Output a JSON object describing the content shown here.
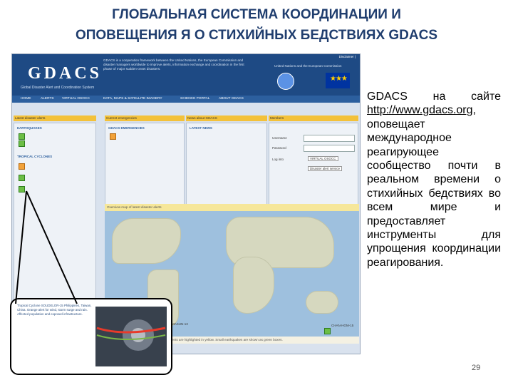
{
  "slide": {
    "title_line1": "ГЛОБАЛЬНАЯ СИСТЕМА КООРДИНАЦИИ И",
    "title_line2": "ОПОВЕЩЕНИЯ Я О СТИХИЙНЫХ БЕДСТВИЯХ GDACS",
    "body_before_link": "GDACS на сайте ",
    "link": "http://www.gdacs.org",
    "body_after_link": ", оповещает международное реагирующее сообщество почти в реальном времени о стихийных бедствиях во всем мире и предоставляет инструменты для упрощения координации реагирования.",
    "page_number": "29"
  },
  "screenshot": {
    "logo": "GDACS",
    "logo_subtitle": "Global Disaster Alert and Coordination System",
    "header_text": "GDACS is a cooperation framework between the United Nations, the European Commission and disaster managers worldwide to improve alerts, information exchange and coordination in the first phase of major sudden-onset disasters.",
    "header_right": "United Nations and the European Commission",
    "disclaimer": "Disclaimer |",
    "nav": [
      "HOME",
      "ALERTS",
      "VIRTUAL OSOCC",
      "DATA, MAPS & SATELLITE IMAGERY",
      "SCIENCE PORTAL",
      "ABOUT GDACS"
    ],
    "panels": [
      "Latest disaster alerts",
      "Current emergencies",
      "News about GDACS",
      "Members"
    ],
    "sub_heads": [
      "EARTHQUAKES",
      "GDACS EMERGENCIES",
      "LATEST NEWS",
      "TROPICAL CYCLONES"
    ],
    "login_labels": [
      "Username",
      "Password",
      "Log into",
      "Disaster alert service"
    ],
    "login_button": "VIRTUAL OSOCC",
    "map_band": "Overview map of latest disaster alerts",
    "map_labels": [
      "RAMMASUN-13",
      "CHAN-HOM-15"
    ],
    "map_footer": "Last 24 hours events are highlighted in yellow. Small earthquakes are shown as green boxes.",
    "callout_text": "Tropical Cyclone SOUDELOR-15 Philippines, Taiwan, China. Orange alert for wind, storm surge and rain. Affected population and exposed infrastructure."
  }
}
